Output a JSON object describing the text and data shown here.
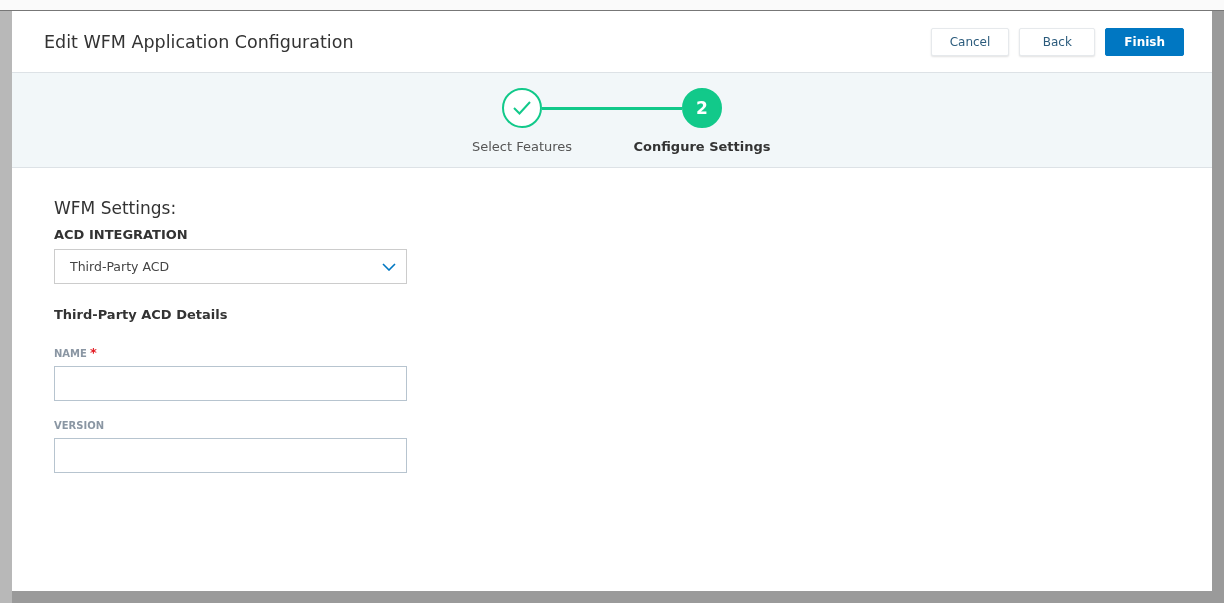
{
  "dialog": {
    "title": "Edit WFM Application Configuration",
    "buttons": [
      {
        "label": "Cancel",
        "kind": "secondary"
      },
      {
        "label": "Back",
        "kind": "secondary"
      },
      {
        "label": "Finish",
        "kind": "primary"
      }
    ]
  },
  "steps": [
    {
      "label": "Select Features",
      "completed": true,
      "selected": false
    },
    {
      "label": "Configure Settings",
      "number": "2",
      "completed": false,
      "selected": true
    }
  ],
  "settings": {
    "title": "WFM Settings:",
    "acd_label": "ACD INTEGRATION",
    "acd_value": "Third-Party ACD",
    "details_heading": "Third-Party ACD Details",
    "fields": [
      {
        "label": "NAME",
        "required_mark": "*"
      },
      {
        "label": "VERSION"
      }
    ]
  }
}
